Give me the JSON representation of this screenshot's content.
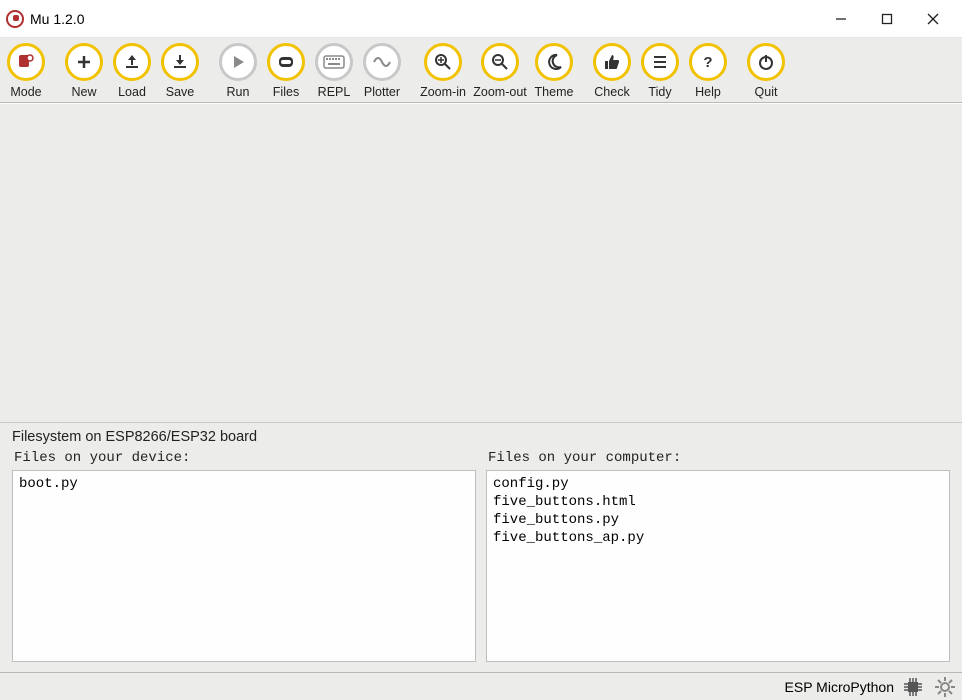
{
  "window": {
    "title": "Mu 1.2.0"
  },
  "toolbar": {
    "mode": "Mode",
    "new": "New",
    "load": "Load",
    "save": "Save",
    "run": "Run",
    "files": "Files",
    "repl": "REPL",
    "plotter": "Plotter",
    "zoom_in": "Zoom-in",
    "zoom_out": "Zoom-out",
    "theme": "Theme",
    "check": "Check",
    "tidy": "Tidy",
    "help": "Help",
    "quit": "Quit"
  },
  "filesystem": {
    "panel_title": "Filesystem on ESP8266/ESP32 board",
    "device_label": "Files on your device:",
    "computer_label": "Files on your computer:",
    "device_files": [
      "boot.py"
    ],
    "computer_files": [
      "config.py",
      "five_buttons.html",
      "five_buttons.py",
      "five_buttons_ap.py"
    ]
  },
  "status": {
    "mode_label": "ESP MicroPython"
  }
}
